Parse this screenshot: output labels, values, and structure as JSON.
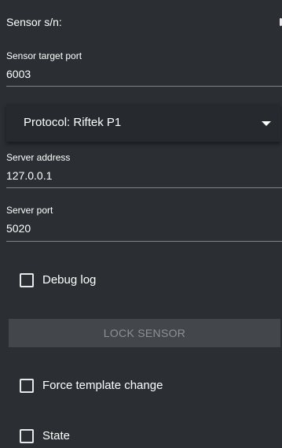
{
  "sensor_sn": {
    "label": "Sensor s/n:"
  },
  "sensor_target_port": {
    "label": "Sensor target port",
    "value": "6003"
  },
  "protocol": {
    "selected": "Protocol: Riftek P1"
  },
  "server_address": {
    "label": "Server address",
    "value": "127.0.0.1"
  },
  "server_port": {
    "label": "Server port",
    "value": "5020"
  },
  "debug_log": {
    "label": "Debug log",
    "checked": false
  },
  "lock_sensor": {
    "label": "LOCK SENSOR",
    "enabled": false
  },
  "force_template_change": {
    "label": "Force template change",
    "checked": false
  },
  "state": {
    "label": "State",
    "checked": false
  },
  "colors": {
    "background": "#2b2f33",
    "text": "#ffffff",
    "disabled_text": "#8b9196",
    "button_disabled_bg": "#43474b",
    "divider": "#7f8388"
  }
}
